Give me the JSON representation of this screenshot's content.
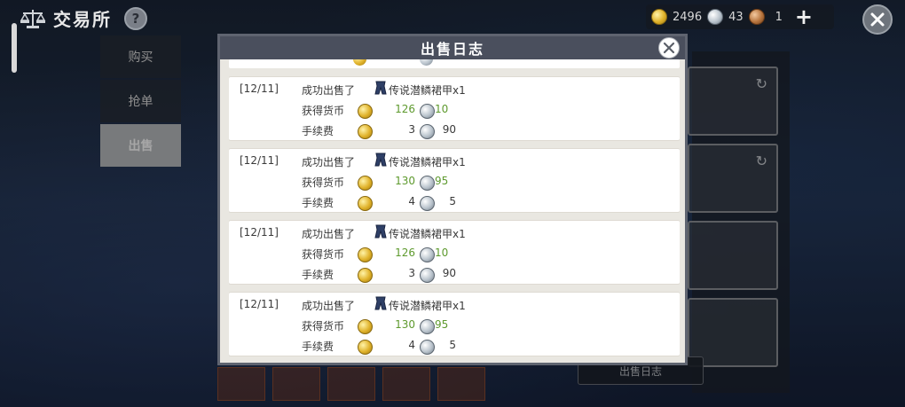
{
  "header": {
    "title": "交易所",
    "help_icon": "question-icon"
  },
  "currency": {
    "gold": "2496",
    "silver": "43",
    "copper": "1",
    "add_icon": "plus-icon"
  },
  "tabs": [
    {
      "label": "购买"
    },
    {
      "label": "抢单"
    },
    {
      "label": "出售",
      "active": true
    }
  ],
  "background": {
    "sale_log_button": "出售日志"
  },
  "modal": {
    "title": "出售日志",
    "close_icon": "close-icon",
    "row_labels": {
      "success": "成功出售了",
      "earned": "获得货币",
      "fee": "手续费"
    },
    "entries": [
      {
        "date": "[12/11]",
        "item": "传说潜鳞裙甲x1",
        "earned_gold": "126",
        "earned_silver": "10",
        "fee_gold": "3",
        "fee_silver": "90"
      },
      {
        "date": "[12/11]",
        "item": "传说潜鳞裙甲x1",
        "earned_gold": "130",
        "earned_silver": "95",
        "fee_gold": "4",
        "fee_silver": "5"
      },
      {
        "date": "[12/11]",
        "item": "传说潜鳞裙甲x1",
        "earned_gold": "126",
        "earned_silver": "10",
        "fee_gold": "3",
        "fee_silver": "90"
      },
      {
        "date": "[12/11]",
        "item": "传说潜鳞裙甲x1",
        "earned_gold": "130",
        "earned_silver": "95",
        "fee_gold": "4",
        "fee_silver": "5"
      }
    ]
  },
  "colors": {
    "earned_value": "#5e9a2e",
    "modal_header": "#4a4f5d",
    "modal_body": "#e9e7e1"
  }
}
